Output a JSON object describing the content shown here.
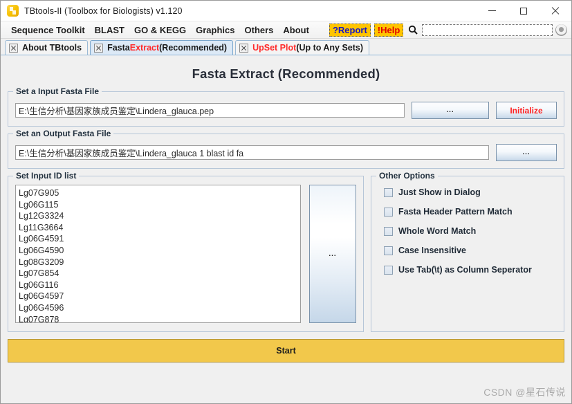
{
  "window": {
    "title": "TBtools-II (Toolbox for Biologists) v1.120",
    "app_icon": "tbtools-logo-icon",
    "controls": {
      "minimize": "minimize-icon",
      "maximize": "maximize-icon",
      "close": "close-icon"
    }
  },
  "menubar": {
    "items": [
      {
        "label": "Sequence Toolkit"
      },
      {
        "label": "BLAST"
      },
      {
        "label": "GO & KEGG"
      },
      {
        "label": "Graphics"
      },
      {
        "label": "Others"
      },
      {
        "label": "About"
      }
    ],
    "report_label": "?Report",
    "help_label": "!Help",
    "search_icon": "search-icon",
    "search_value": "",
    "search_placeholder": "",
    "status_knob": "status-indicator-icon",
    "colors": {
      "hot_background": "#ffc400",
      "report_text": "#1616c8",
      "help_text": "#e10000"
    }
  },
  "tabs": [
    {
      "label": "About TBtools",
      "parts": [
        {
          "text": "About TBtools",
          "color": "dark"
        }
      ],
      "active": false
    },
    {
      "label": "Fasta Extract (Recommended)",
      "parts": [
        {
          "text": "Fasta ",
          "color": "dark"
        },
        {
          "text": "Extract",
          "color": "red"
        },
        {
          "text": " (Recommended)",
          "color": "dark"
        }
      ],
      "active": true
    },
    {
      "label": "UpSet Plot (Up to Any Sets)",
      "parts": [
        {
          "text": "UpSet Plot",
          "color": "red"
        },
        {
          "text": " (Up to Any Sets)",
          "color": "dark"
        }
      ],
      "active": false
    }
  ],
  "page": {
    "title": "Fasta Extract (Recommended)"
  },
  "input_fasta": {
    "group_title": "Set a Input Fasta File",
    "value": "E:\\生信分析\\基因家族成员鉴定\\Lindera_glauca.pep",
    "placeholder": "",
    "browse_label": "...",
    "initialize_label": "Initialize"
  },
  "output_fasta": {
    "group_title": "Set an Output Fasta File",
    "value": "E:\\生信分析\\基因家族成员鉴定\\Lindera_glauca 1 blast id fa",
    "placeholder": "",
    "browse_label": "..."
  },
  "id_list": {
    "group_title": "Set Input ID list",
    "browse_label": "...",
    "ids": [
      "Lg07G905",
      "Lg06G115",
      "Lg12G3324",
      "Lg11G3664",
      "Lg06G4591",
      "Lg06G4590",
      "Lg08G3209",
      "Lg07G854",
      "Lg06G116",
      "Lg06G4597",
      "Lg06G4596",
      "Lg07G878"
    ]
  },
  "other_options": {
    "group_title": "Other Options",
    "checkboxes": [
      {
        "label": "Just Show in Dialog",
        "checked": false
      },
      {
        "label": "Fasta Header Pattern Match",
        "checked": false
      },
      {
        "label": "Whole Word Match",
        "checked": false
      },
      {
        "label": "Case Insensitive",
        "checked": false
      },
      {
        "label": "Use Tab(\\t) as Column Seperator",
        "checked": false
      }
    ]
  },
  "start": {
    "label": "Start",
    "color": "#f2c84b"
  },
  "watermark": {
    "text": "CSDN @星石传说"
  }
}
